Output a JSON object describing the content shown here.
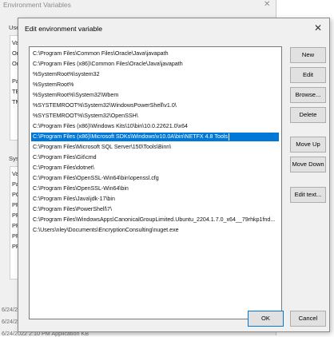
{
  "background_window": {
    "title": "Environment Variables",
    "close_glyph": "✕",
    "user_group_label": "User",
    "user_rows": [
      "Va",
      "On",
      "Or",
      "Pa",
      "TE",
      "TM"
    ],
    "system_group_label": "Syste",
    "system_rows": [
      "Va",
      "Pa",
      "PC",
      "PR",
      "PR",
      "PR",
      "PR",
      "PR"
    ],
    "bottom_rows": [
      "6/24/202",
      "6/24/202",
      "6/24/2022 2:10 PM     Application          KB"
    ]
  },
  "dialog": {
    "title": "Edit environment variable",
    "close_glyph": "✕",
    "paths": [
      "C:\\Program Files\\Common Files\\Oracle\\Java\\javapath",
      "C:\\Program Files (x86)\\Common Files\\Oracle\\Java\\javapath",
      "%SystemRoot%\\system32",
      "%SystemRoot%",
      "%SystemRoot%\\System32\\Wbem",
      "%SYSTEMROOT%\\System32\\WindowsPowerShell\\v1.0\\",
      "%SYSTEMROOT%\\System32\\OpenSSH\\",
      "C:\\Program Files (x86)\\Windows Kits\\10\\bin\\10.0.22621.0\\x64",
      "C:\\Program Files (x86)\\Microsoft SDKs\\Windows\\v10.0A\\bin\\NETFX 4.8 Tools",
      "C:\\Program Files\\Microsoft SQL Server\\150\\Tools\\Binn\\",
      "C:\\Program Files\\Git\\cmd",
      "C:\\Program Files\\dotnet\\",
      "C:\\Program Files\\OpenSSL-Win64\\bin\\openssl.cfg",
      "C:\\Program Files\\OpenSSL-Win64\\bin",
      "C:\\Program Files\\Java\\jdk-17\\bin",
      "C:\\Program Files\\PowerShell\\7\\",
      "C:\\Program Files\\WindowsApps\\CanonicalGroupLimited.Ubuntu_2204.1.7.0_x64__79rhkp1fnd...",
      "C:\\Users\\nley\\Documents\\EncryptionConsulting\\nuget.exe"
    ],
    "selected_index": 8,
    "buttons": {
      "new": "New",
      "edit": "Edit",
      "browse": "Browse...",
      "delete": "Delete",
      "move_up": "Move Up",
      "move_down": "Move Down",
      "edit_text": "Edit text...",
      "ok": "OK",
      "cancel": "Cancel"
    }
  },
  "colors": {
    "selection": "#0078d7",
    "dialog_bg": "#f0f0f0",
    "button_bg": "#e1e1e1"
  }
}
